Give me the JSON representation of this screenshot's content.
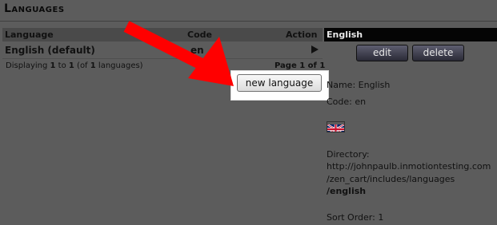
{
  "header": {
    "title": "Languages"
  },
  "table": {
    "columns": [
      "Language",
      "Code",
      "Action"
    ],
    "rows": [
      {
        "language": "English (default)",
        "code": "en"
      }
    ],
    "display_prefix": "Displaying ",
    "display_from": "1",
    "display_mid": " to ",
    "display_to": "1",
    "display_of_prefix": " (of ",
    "display_total": "1",
    "display_suffix": " languages)",
    "page_info": "Page 1 of 1"
  },
  "actions": {
    "new_language": "new language"
  },
  "details": {
    "title": "English",
    "edit_label": "edit",
    "delete_label": "delete",
    "name_line": "Name: English",
    "code_line": "Code: en",
    "directory_label": "Directory:",
    "directory_path_1": "http://johnpaulb.inmotiontesting.com",
    "directory_path_2": "/zen_cart/includes/languages",
    "directory_path_3": "/english",
    "sort_order": "Sort Order: 1",
    "flag_icon": "uk-flag-icon"
  },
  "colors": {
    "arrow": "#ff0000",
    "background": "#5c5c5c",
    "panel_header": "#050505"
  }
}
